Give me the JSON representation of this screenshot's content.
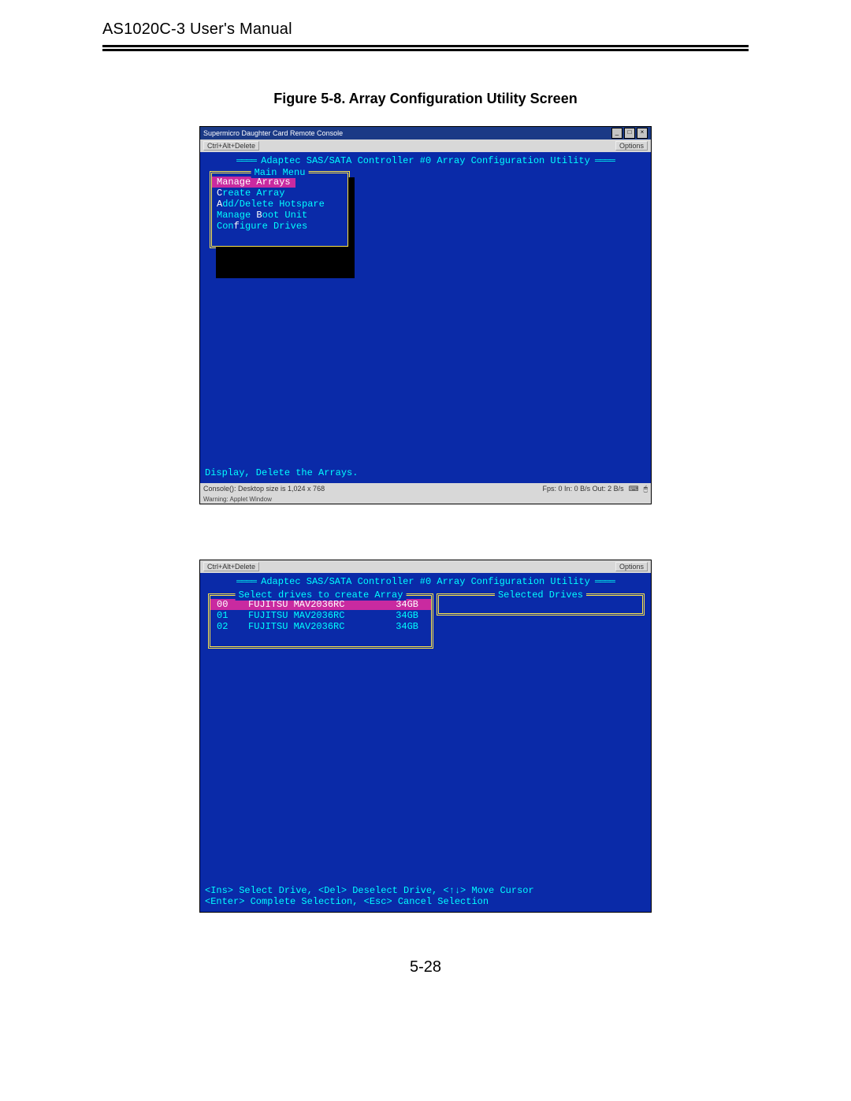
{
  "document": {
    "header_title": "AS1020C-3 User's Manual",
    "figure_caption": "Figure 5-8. Array Configuration Utility Screen",
    "page_number": "5-28"
  },
  "screenshot1": {
    "window_title": "Supermicro Daughter Card Remote Console",
    "menubar_left": "Ctrl+Alt+Delete",
    "menubar_right": "Options",
    "banner": "Adaptec SAS/SATA Controller #0 Array Configuration Utility",
    "main_menu_title": "Main Menu",
    "menu_items": [
      {
        "hot": "M",
        "rest": "anage Arrays",
        "selected": true
      },
      {
        "hot": "C",
        "rest": "reate Array",
        "selected": false
      },
      {
        "hot": "A",
        "rest": "dd/Delete Hotspare",
        "selected": false
      },
      {
        "before": "Manage ",
        "hot": "B",
        "rest": "oot Unit",
        "selected": false
      },
      {
        "before": "Con",
        "hot": "f",
        "rest": "igure Drives",
        "selected": false
      }
    ],
    "hint": "Display, Delete the Arrays.",
    "status_left": "Console(): Desktop size is 1,024 x 768",
    "status_right": "Fps: 0 In: 0 B/s Out: 2 B/s",
    "warning": "Warning: Applet Window"
  },
  "screenshot2": {
    "menubar_left": "Ctrl+Alt+Delete",
    "menubar_right": "Options",
    "banner": "Adaptec SAS/SATA Controller #0 Array Configuration Utility",
    "left_box_title": "Select drives to create Array",
    "right_box_title": "Selected Drives",
    "drives": [
      {
        "id": "00",
        "model": "FUJITSU MAV2036RC",
        "size": "34GB",
        "selected": true
      },
      {
        "id": "01",
        "model": "FUJITSU MAV2036RC",
        "size": "34GB",
        "selected": false
      },
      {
        "id": "02",
        "model": "FUJITSU MAV2036RC",
        "size": "34GB",
        "selected": false
      }
    ],
    "help_line1": "<Ins> Select Drive, <Del> Deselect Drive, <↑↓> Move Cursor",
    "help_line2": "<Enter> Complete Selection, <Esc> Cancel Selection"
  }
}
